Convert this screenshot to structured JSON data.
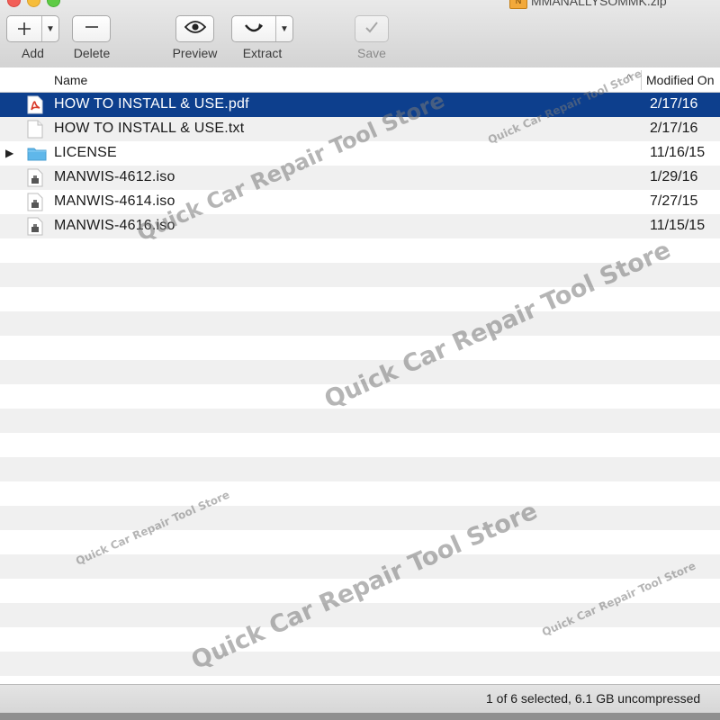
{
  "window": {
    "title": "MMANALLYSOMMK.zip",
    "zip_badge": "N"
  },
  "toolbar": {
    "add_label": "Add",
    "delete_label": "Delete",
    "preview_label": "Preview",
    "extract_label": "Extract",
    "save_label": "Save"
  },
  "columns": {
    "name": "Name",
    "modified": "Modified On"
  },
  "files": [
    {
      "name": "HOW TO INSTALL & USE.pdf",
      "date": "2/17/16",
      "icon": "pdf-file-icon",
      "selected": true
    },
    {
      "name": "HOW TO INSTALL & USE.txt",
      "date": "2/17/16",
      "icon": "text-file-icon",
      "selected": false
    },
    {
      "name": "LICENSE",
      "date": "11/16/15",
      "icon": "folder-icon",
      "selected": false
    },
    {
      "name": "MANWIS-4612.iso",
      "date": "1/29/16",
      "icon": "disk-image-icon",
      "selected": false
    },
    {
      "name": "MANWIS-4614.iso",
      "date": "7/27/15",
      "icon": "disk-image-icon",
      "selected": false
    },
    {
      "name": "MANWIS-4616.iso",
      "date": "11/15/15",
      "icon": "disk-image-icon",
      "selected": false
    }
  ],
  "status": {
    "text": "1 of 6 selected, 6.1 GB uncompressed"
  },
  "watermarks": {
    "text": "Quick Car Repair Tool Store"
  },
  "colors": {
    "selection": "#0d3f8d",
    "folder": "#5fb7ea",
    "pdf": "#d93a2b"
  }
}
